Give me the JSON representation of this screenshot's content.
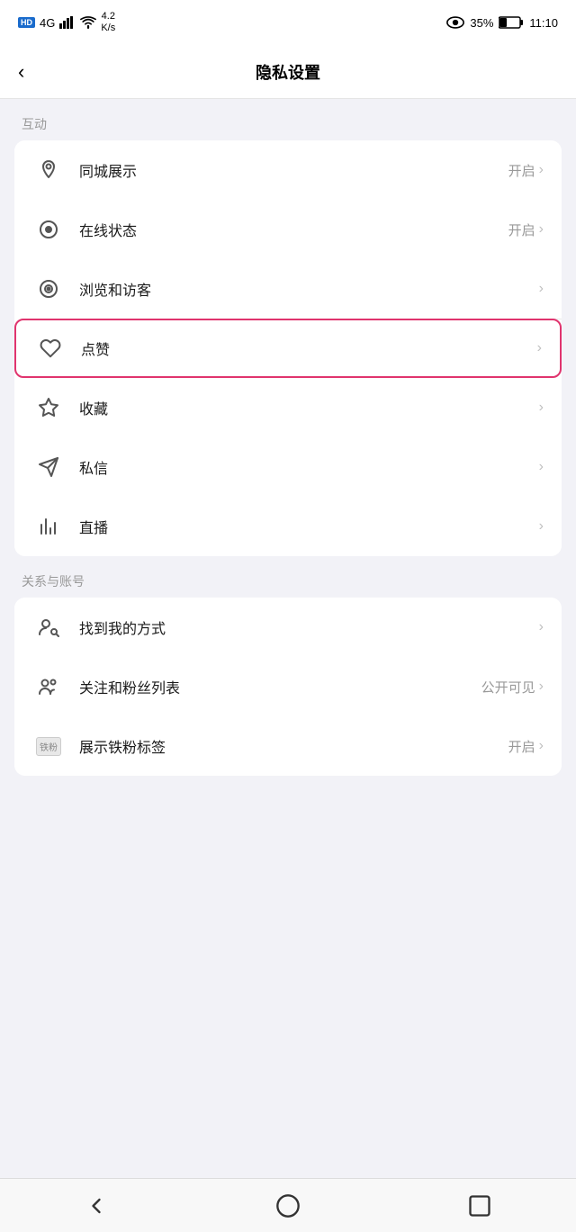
{
  "statusBar": {
    "hdLabel": "HD",
    "signal": "4G",
    "wifi": "4.2\nK/s",
    "battery": "35%",
    "time": "11:10"
  },
  "header": {
    "title": "隐私设置",
    "backLabel": "‹"
  },
  "sections": [
    {
      "label": "互动",
      "items": [
        {
          "id": "tongcheng",
          "icon": "location",
          "text": "同城展示",
          "status": "开启",
          "hasChevron": true,
          "highlighted": false
        },
        {
          "id": "zaixian",
          "icon": "online",
          "text": "在线状态",
          "status": "开启",
          "hasChevron": true,
          "highlighted": false
        },
        {
          "id": "liulan",
          "icon": "eye",
          "text": "浏览和访客",
          "status": "",
          "hasChevron": true,
          "highlighted": false
        },
        {
          "id": "dianzan",
          "icon": "heart",
          "text": "点赞",
          "status": "",
          "hasChevron": true,
          "highlighted": true
        },
        {
          "id": "shoucang",
          "icon": "star",
          "text": "收藏",
          "status": "",
          "hasChevron": true,
          "highlighted": false
        },
        {
          "id": "sixin",
          "icon": "message",
          "text": "私信",
          "status": "",
          "hasChevron": true,
          "highlighted": false
        },
        {
          "id": "zhibo",
          "icon": "bar",
          "text": "直播",
          "status": "",
          "hasChevron": true,
          "highlighted": false
        }
      ]
    },
    {
      "label": "关系与账号",
      "items": [
        {
          "id": "zhaodao",
          "icon": "person-search",
          "text": "找到我的方式",
          "status": "",
          "hasChevron": true,
          "highlighted": false
        },
        {
          "id": "guanzhu",
          "icon": "persons",
          "text": "关注和粉丝列表",
          "status": "公开可见",
          "hasChevron": true,
          "highlighted": false
        },
        {
          "id": "tiefan",
          "icon": "tiefan",
          "text": "展示铁粉标签",
          "status": "开启",
          "hasChevron": true,
          "highlighted": false
        }
      ]
    }
  ],
  "bottomNav": {
    "back": "back",
    "home": "home",
    "recent": "recent"
  }
}
